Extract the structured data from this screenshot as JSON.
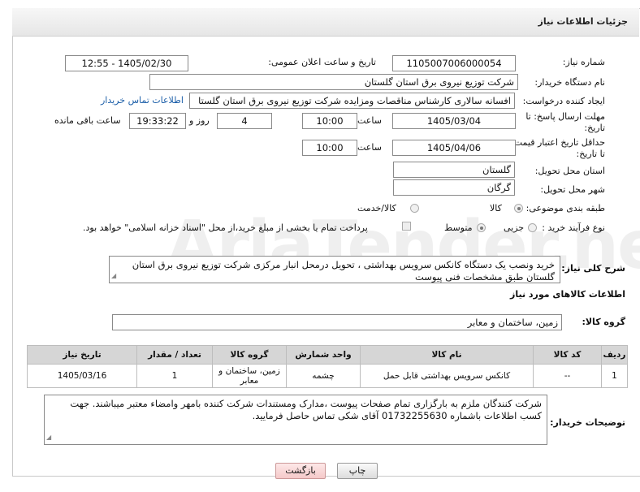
{
  "header": {
    "title": "جزئیات اطلاعات نیاز"
  },
  "fields": {
    "need_number_label": "شماره نیاز:",
    "need_number": "1105007006000054",
    "announce_label": "تاریخ و ساعت اعلان عمومی:",
    "announce_value": "1405/02/30 - 12:55",
    "buyer_org_label": "نام دستگاه خریدار:",
    "buyer_org": "شرکت توزیع نیروی برق استان گلستان",
    "requester_label": "ایجاد کننده درخواست:",
    "requester": "افسانه سالاری کارشناس مناقصات ومزایده شرکت توزیع نیروی برق استان گلستا",
    "buyer_contact_link": "اطلاعات تماس خریدار",
    "reply_deadline_label_1": "مهلت ارسال پاسخ: تا",
    "reply_deadline_label_2": "تاریخ:",
    "reply_date": "1405/03/04",
    "time_label": "ساعت",
    "reply_time": "10:00",
    "days_value": "4",
    "days_label": "روز و",
    "remaining_time": "19:33:22",
    "remaining_label": "ساعت باقی مانده",
    "price_valid_label_1": "حداقل تاریخ اعتبار قیمت:",
    "price_valid_label_2": "تا تاریخ:",
    "price_date": "1405/04/06",
    "price_time": "10:00",
    "province_label": "استان محل تحویل:",
    "province": "گلستان",
    "city_label": "شهر محل تحویل:",
    "city": "گرگان",
    "category_label": "طبقه بندی موضوعی:",
    "category_options": [
      "کالا",
      "کالا/خدمت"
    ],
    "purchase_type_label": "نوع فرآیند خرید :",
    "purchase_options": [
      "جزیی",
      "متوسط"
    ],
    "payment_note": "پرداخت تمام یا بخشی از مبلغ خرید،از محل \"اسناد خزانه اسلامی\" خواهد بود."
  },
  "description": {
    "label": "شرح کلی نیاز:",
    "text": "خرید ونصب یک دستگاه کانکس سرویس بهداشتی ، تحویل درمحل انبار مرکزی شرکت توزیع نیروی برق استان گلستان طبق مشخصات فنی پیوست"
  },
  "goods": {
    "section_title": "اطلاعات کالاهای مورد نیاز",
    "group_label": "گروه کالا:",
    "group_value": "زمین، ساختمان و معابر",
    "columns": [
      "ردیف",
      "کد کالا",
      "نام کالا",
      "واحد شمارش",
      "گروه کالا",
      "تعداد / مقدار",
      "تاریخ نیاز"
    ],
    "rows": [
      [
        "1",
        "--",
        "کانکس سرویس بهداشتی قابل حمل",
        "چشمه",
        "زمین، ساختمان و معابر",
        "1",
        "1405/03/16"
      ]
    ]
  },
  "buyer_notes": {
    "label": "توضیحات خریدار:",
    "text": "شرکت کنندگان ملزم به بارگزاری تمام صفحات پیوست ،مدارک ومستندات شرکت کننده بامهر وامضاء معتبر میباشند. جهت کسب اطلاعات باشماره 01732255630 آقای شکی تماس حاصل فرمایید."
  },
  "buttons": {
    "print": "چاپ",
    "back": "بازگشت"
  },
  "watermark": "AriaTender.neT"
}
